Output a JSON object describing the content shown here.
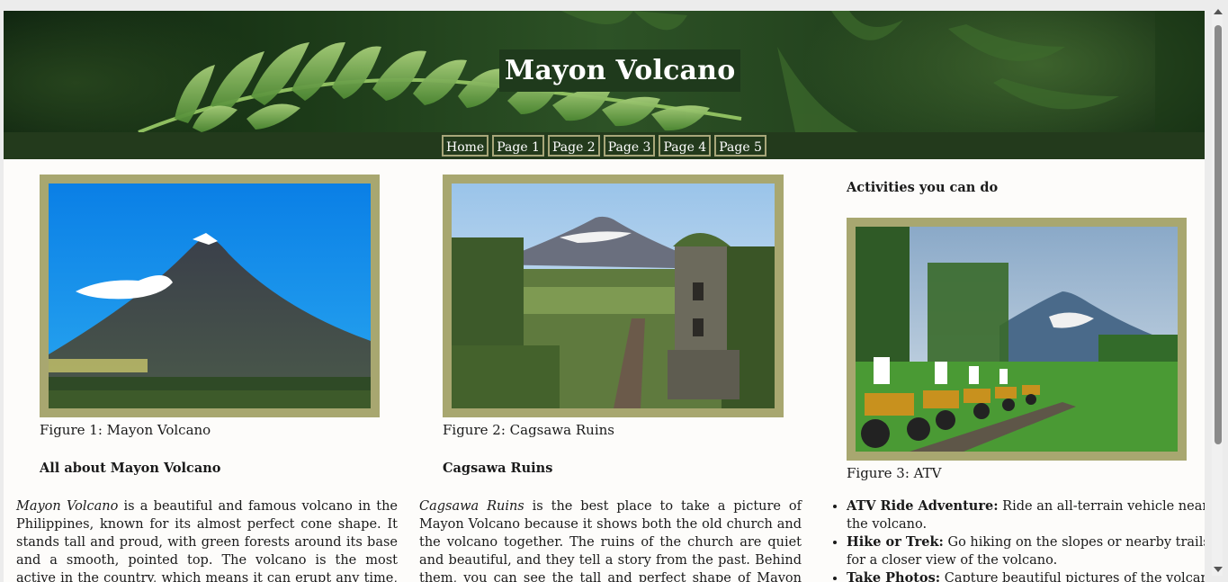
{
  "header": {
    "title": "Mayon Volcano"
  },
  "nav": [
    {
      "label": "Home"
    },
    {
      "label": "Page 1"
    },
    {
      "label": "Page 2"
    },
    {
      "label": "Page 3"
    },
    {
      "label": "Page 4"
    },
    {
      "label": "Page 5"
    }
  ],
  "columns": [
    {
      "caption": "Figure 1: Mayon Volcano",
      "heading": "All about Mayon Volcano",
      "para_em": "Mayon Volcano",
      "para_rest": " is a beautiful and famous volcano in the Philippines, known for its almost perfect cone shape. It stands tall and proud, with green forests around its base and a smooth, pointed top. The volcano is the most active in the country, which means it can erupt any time, and sometimes it"
    },
    {
      "caption": "Figure 2: Cagsawa Ruins",
      "heading": "Cagsawa Ruins",
      "para_em": "Cagsawa Ruins",
      "para_rest": " is the best place to take a picture of Mayon Volcano because it shows both the old church and the volcano together. The ruins of the church are quiet and beautiful, and they tell a story from the past. Behind them, you can see the tall and perfect shape of Mayon Volcano. The view is clear and"
    },
    {
      "heading": "Activities you can do",
      "caption": "Figure 3: ATV",
      "activities": [
        {
          "title": "ATV Ride Adventure:",
          "text": " Ride an all-terrain vehicle near the volcano."
        },
        {
          "title": "Hike or Trek:",
          "text": " Go hiking on the slopes or nearby trails for a closer view of the volcano."
        },
        {
          "title": "Take Photos:",
          "text": " Capture beautiful pictures of the volcano."
        }
      ]
    }
  ]
}
